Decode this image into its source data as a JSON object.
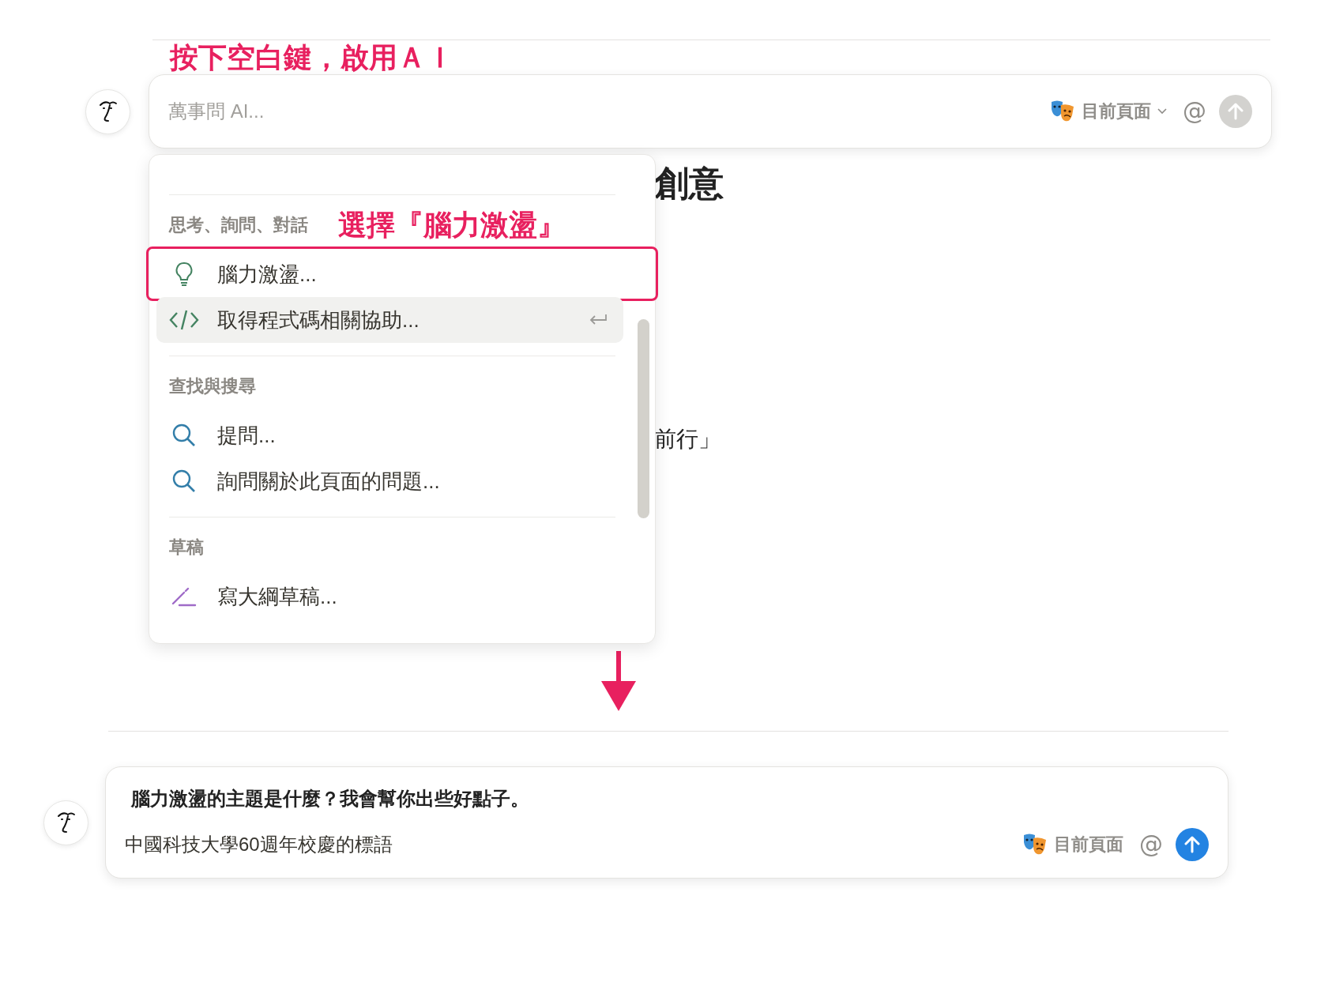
{
  "step1": {
    "annotation": "按下空白鍵，啟用ＡＩ",
    "prompt": {
      "placeholder": "萬事問 AI...",
      "scope": "目前頁面",
      "mention": "@",
      "send_disabled": true
    }
  },
  "page_behind": {
    "heading": "創意",
    "line": "前行」"
  },
  "menu": {
    "sections": [
      {
        "title": "思考、詢問、對話",
        "annotation": "選擇『腦力激盪』",
        "items": [
          {
            "kind": "bulb",
            "label": "腦力激盪...",
            "selected": false,
            "annotated": true
          },
          {
            "kind": "code",
            "label": "取得程式碼相關協助...",
            "selected": true,
            "annotated": false
          }
        ]
      },
      {
        "title": "查找與搜尋",
        "items": [
          {
            "kind": "search",
            "label": "提問...",
            "selected": false,
            "annotated": false
          },
          {
            "kind": "search",
            "label": "詢問關於此頁面的問題...",
            "selected": false,
            "annotated": false
          }
        ]
      },
      {
        "title": "草稿",
        "items": [
          {
            "kind": "pencil",
            "label": "寫大綱草稿...",
            "selected": false,
            "annotated": false
          }
        ]
      }
    ]
  },
  "step2": {
    "prompt": {
      "question": "腦力激盪的主題是什麼？我會幫你出些好點子。",
      "value": "中國科技大學60週年校慶的標語",
      "scope": "目前頁面",
      "mention": "@",
      "send_disabled": false
    }
  }
}
